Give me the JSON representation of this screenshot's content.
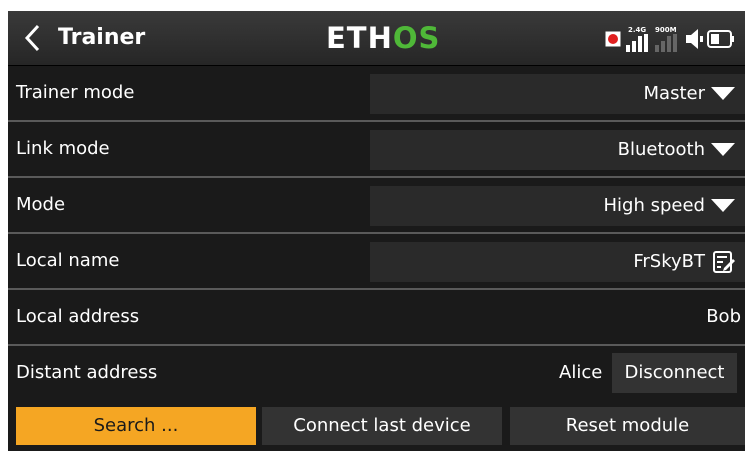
{
  "header": {
    "back_icon": "chevron-left-icon",
    "title": "Trainer",
    "logo_main": "ETH",
    "logo_accent": "OS",
    "status_icons": [
      "record-icon",
      "2.4g-signal-icon",
      "900m-signal-icon",
      "speaker-icon",
      "battery-icon"
    ],
    "signal_2g_label": "2.4G",
    "signal_900m_label": "900M"
  },
  "rows": {
    "trainer_mode": {
      "label": "Trainer mode",
      "value": "Master"
    },
    "link_mode": {
      "label": "Link mode",
      "value": "Bluetooth"
    },
    "mode": {
      "label": "Mode",
      "value": "High speed"
    },
    "local_name": {
      "label": "Local name",
      "value": "FrSkyBT"
    },
    "local_address": {
      "label": "Local address",
      "value": "Bob"
    },
    "distant_address": {
      "label": "Distant address",
      "value": "Alice",
      "button": "Disconnect"
    }
  },
  "buttons": {
    "search": "Search ...",
    "connect_last": "Connect last device",
    "reset": "Reset module"
  },
  "colors": {
    "accent": "#f5a623",
    "logo_os": "#4fb838",
    "record": "#e02020",
    "background": "#1a1a1a"
  }
}
